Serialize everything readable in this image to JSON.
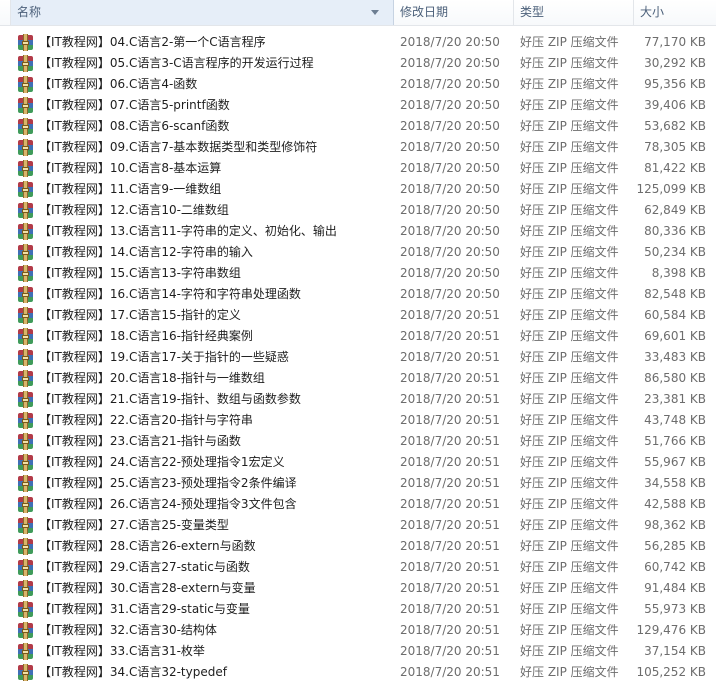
{
  "columns": {
    "name": "名称",
    "date": "修改日期",
    "type": "类型",
    "size": "大小"
  },
  "files": [
    {
      "name": "【IT教程网】04.C语言2-第一个C语言程序",
      "date": "2018/7/20 20:50",
      "type": "好压 ZIP 压缩文件",
      "size": "77,170 KB"
    },
    {
      "name": "【IT教程网】05.C语言3-C语言程序的开发运行过程",
      "date": "2018/7/20 20:50",
      "type": "好压 ZIP 压缩文件",
      "size": "30,292 KB"
    },
    {
      "name": "【IT教程网】06.C语言4-函数",
      "date": "2018/7/20 20:50",
      "type": "好压 ZIP 压缩文件",
      "size": "95,356 KB"
    },
    {
      "name": "【IT教程网】07.C语言5-printf函数",
      "date": "2018/7/20 20:50",
      "type": "好压 ZIP 压缩文件",
      "size": "39,406 KB"
    },
    {
      "name": "【IT教程网】08.C语言6-scanf函数",
      "date": "2018/7/20 20:50",
      "type": "好压 ZIP 压缩文件",
      "size": "53,682 KB"
    },
    {
      "name": "【IT教程网】09.C语言7-基本数据类型和类型修饰符",
      "date": "2018/7/20 20:50",
      "type": "好压 ZIP 压缩文件",
      "size": "78,305 KB"
    },
    {
      "name": "【IT教程网】10.C语言8-基本运算",
      "date": "2018/7/20 20:50",
      "type": "好压 ZIP 压缩文件",
      "size": "81,422 KB"
    },
    {
      "name": "【IT教程网】11.C语言9-一维数组",
      "date": "2018/7/20 20:50",
      "type": "好压 ZIP 压缩文件",
      "size": "125,099 KB"
    },
    {
      "name": "【IT教程网】12.C语言10-二维数组",
      "date": "2018/7/20 20:50",
      "type": "好压 ZIP 压缩文件",
      "size": "62,849 KB"
    },
    {
      "name": "【IT教程网】13.C语言11-字符串的定义、初始化、输出",
      "date": "2018/7/20 20:50",
      "type": "好压 ZIP 压缩文件",
      "size": "80,336 KB"
    },
    {
      "name": "【IT教程网】14.C语言12-字符串的输入",
      "date": "2018/7/20 20:50",
      "type": "好压 ZIP 压缩文件",
      "size": "50,234 KB"
    },
    {
      "name": "【IT教程网】15.C语言13-字符串数组",
      "date": "2018/7/20 20:50",
      "type": "好压 ZIP 压缩文件",
      "size": "8,398 KB"
    },
    {
      "name": "【IT教程网】16.C语言14-字符和字符串处理函数",
      "date": "2018/7/20 20:50",
      "type": "好压 ZIP 压缩文件",
      "size": "82,548 KB"
    },
    {
      "name": "【IT教程网】17.C语言15-指针的定义",
      "date": "2018/7/20 20:51",
      "type": "好压 ZIP 压缩文件",
      "size": "60,584 KB"
    },
    {
      "name": "【IT教程网】18.C语言16-指针经典案例",
      "date": "2018/7/20 20:51",
      "type": "好压 ZIP 压缩文件",
      "size": "69,601 KB"
    },
    {
      "name": "【IT教程网】19.C语言17-关于指针的一些疑惑",
      "date": "2018/7/20 20:51",
      "type": "好压 ZIP 压缩文件",
      "size": "33,483 KB"
    },
    {
      "name": "【IT教程网】20.C语言18-指针与一维数组",
      "date": "2018/7/20 20:51",
      "type": "好压 ZIP 压缩文件",
      "size": "86,580 KB"
    },
    {
      "name": "【IT教程网】21.C语言19-指针、数组与函数参数",
      "date": "2018/7/20 20:51",
      "type": "好压 ZIP 压缩文件",
      "size": "23,381 KB"
    },
    {
      "name": "【IT教程网】22.C语言20-指针与字符串",
      "date": "2018/7/20 20:51",
      "type": "好压 ZIP 压缩文件",
      "size": "43,748 KB"
    },
    {
      "name": "【IT教程网】23.C语言21-指针与函数",
      "date": "2018/7/20 20:51",
      "type": "好压 ZIP 压缩文件",
      "size": "51,766 KB"
    },
    {
      "name": "【IT教程网】24.C语言22-预处理指令1宏定义",
      "date": "2018/7/20 20:51",
      "type": "好压 ZIP 压缩文件",
      "size": "55,967 KB"
    },
    {
      "name": "【IT教程网】25.C语言23-预处理指令2条件编译",
      "date": "2018/7/20 20:51",
      "type": "好压 ZIP 压缩文件",
      "size": "34,558 KB"
    },
    {
      "name": "【IT教程网】26.C语言24-预处理指令3文件包含",
      "date": "2018/7/20 20:51",
      "type": "好压 ZIP 压缩文件",
      "size": "42,588 KB"
    },
    {
      "name": "【IT教程网】27.C语言25-变量类型",
      "date": "2018/7/20 20:51",
      "type": "好压 ZIP 压缩文件",
      "size": "98,362 KB"
    },
    {
      "name": "【IT教程网】28.C语言26-extern与函数",
      "date": "2018/7/20 20:51",
      "type": "好压 ZIP 压缩文件",
      "size": "56,285 KB"
    },
    {
      "name": "【IT教程网】29.C语言27-static与函数",
      "date": "2018/7/20 20:51",
      "type": "好压 ZIP 压缩文件",
      "size": "60,742 KB"
    },
    {
      "name": "【IT教程网】30.C语言28-extern与变量",
      "date": "2018/7/20 20:51",
      "type": "好压 ZIP 压缩文件",
      "size": "91,484 KB"
    },
    {
      "name": "【IT教程网】31.C语言29-static与变量",
      "date": "2018/7/20 20:51",
      "type": "好压 ZIP 压缩文件",
      "size": "55,973 KB"
    },
    {
      "name": "【IT教程网】32.C语言30-结构体",
      "date": "2018/7/20 20:51",
      "type": "好压 ZIP 压缩文件",
      "size": "129,476 KB"
    },
    {
      "name": "【IT教程网】33.C语言31-枚举",
      "date": "2018/7/20 20:51",
      "type": "好压 ZIP 压缩文件",
      "size": "37,154 KB"
    },
    {
      "name": "【IT教程网】34.C语言32-typedef",
      "date": "2018/7/20 20:51",
      "type": "好压 ZIP 压缩文件",
      "size": "105,252 KB"
    }
  ],
  "icon": "zip-archive-icon",
  "colors": {
    "header_text": "#4c607a",
    "sorted_header_bg": "#e6eef8",
    "secondary_text": "#6d6d6d"
  }
}
